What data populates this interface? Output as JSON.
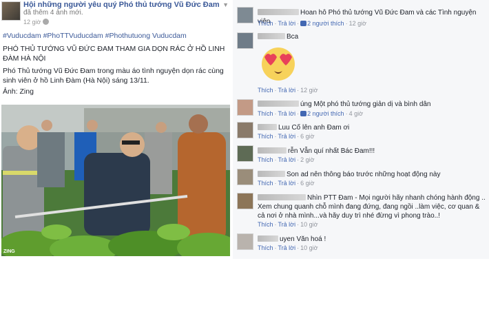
{
  "post": {
    "group_name": "Hội những người yêu quý Phó thủ tướng Vũ Đức Đam",
    "added_photos": "đã thêm 4 ảnh mới.",
    "time": "12 giờ",
    "hashtags": "#Vuducdam #PhoTTVuducdam #Phothutuong Vuducdam",
    "headline": "PHÓ THỦ TƯỚNG VŨ ĐỨC ĐAM THAM GIA DỌN RÁC Ở HỒ LINH ĐÀM HÀ NỘI",
    "paragraph": "Phó Thủ tướng Vũ Đức Đam trong màu áo tình nguyện dọn rác cùng sinh viên ở hồ Linh Đàm (Hà Nội) sáng 13/11.",
    "credit": "Ảnh: Zing",
    "photo_watermark": "ZING"
  },
  "actions": {
    "like": "Thích",
    "reply": "Trả lời",
    "sep": "·"
  },
  "comments": [
    {
      "text": "Hoan hô Phó thủ tướng Vũ Đức Đam và các Tình nguyện viên",
      "likes": "2 người thích",
      "time": "12 giờ"
    },
    {
      "text": "Bca",
      "likes": "",
      "time": "12 giờ"
    },
    {
      "text": "úng Một phó thủ tướng giản dị và bình dân",
      "likes": "2 người thích",
      "time": "4 giờ"
    },
    {
      "text": "Luu Cố lên anh Đam ơi",
      "likes": "",
      "time": "6 giờ"
    },
    {
      "text": "rễn Vẫn quí nhất Bác Đam!!!",
      "likes": "",
      "time": "2 giờ"
    },
    {
      "text": "Son ad nên thông báo trước những hoạt động này",
      "likes": "",
      "time": "6 giờ"
    },
    {
      "text": "Nhìn PTT Đam - Mọi người hãy nhanh chóng hành động .. Xem chung quanh chỗ mình đang đứng, đang ngồi ..làm việc, cơ quan & cả nơi ở nhà mình...và hãy duy trì nhé đừng vì phong trào..!",
      "likes": "",
      "time": "10 giờ"
    },
    {
      "text": "uyen Văn hoá !",
      "likes": "",
      "time": "10 giờ"
    }
  ],
  "icons": [
    "group-avatar",
    "globe-icon",
    "chevron-down-icon",
    "heart-eyes-emoji",
    "like-icon"
  ]
}
